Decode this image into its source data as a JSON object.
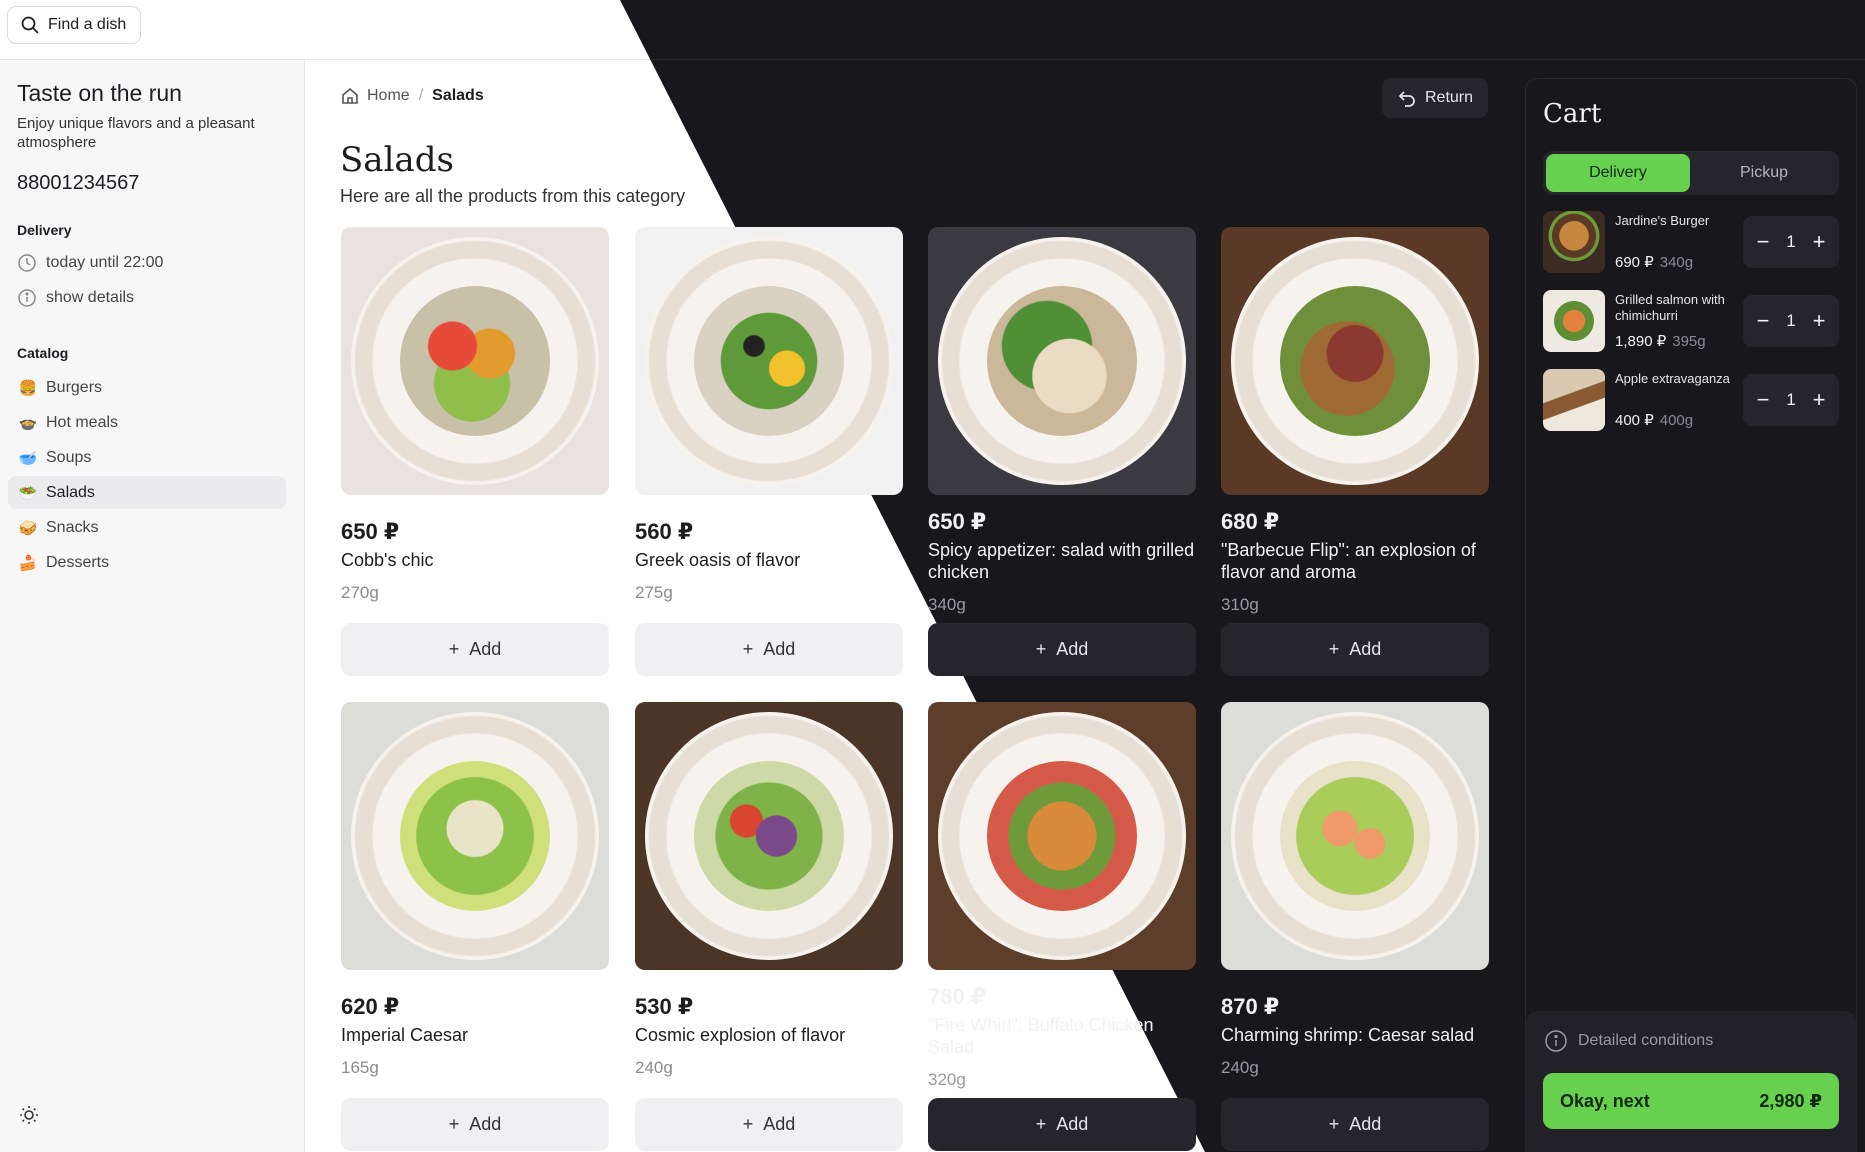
{
  "search": {
    "label": "Find a dish"
  },
  "sidebar": {
    "title": "Taste on the run",
    "subtitle": "Enjoy unique flavors and a pleasant atmosphere",
    "phone": "88001234567",
    "delivery_heading": "Delivery",
    "delivery_time": "today until 22:00",
    "show_details": "show details",
    "catalog_heading": "Catalog",
    "categories": [
      {
        "label": "Burgers",
        "icon": "burger-icon",
        "active": false
      },
      {
        "label": "Hot meals",
        "icon": "hot-meal-icon",
        "active": false
      },
      {
        "label": "Soups",
        "icon": "soup-icon",
        "active": false
      },
      {
        "label": "Salads",
        "icon": "salad-icon",
        "active": true
      },
      {
        "label": "Snacks",
        "icon": "snack-icon",
        "active": false
      },
      {
        "label": "Desserts",
        "icon": "dessert-icon",
        "active": false
      }
    ]
  },
  "breadcrumb": {
    "home": "Home",
    "separator": "/",
    "current": "Salads"
  },
  "return_label": "Return",
  "page": {
    "title": "Salads",
    "subtitle": "Here are all the products from this category"
  },
  "add_label": "Add",
  "products": [
    {
      "price": "650 ₽",
      "name": "Cobb's chic",
      "weight": "270g"
    },
    {
      "price": "560 ₽",
      "name": "Greek oasis of flavor",
      "weight": "275g"
    },
    {
      "price": "650 ₽",
      "name": "Spicy appetizer: salad with grilled chicken",
      "weight": "340g"
    },
    {
      "price": "680 ₽",
      "name": "\"Barbecue Flip\": an explosion of flavor and aroma",
      "weight": "310g"
    },
    {
      "price": "620 ₽",
      "name": "Imperial Caesar",
      "weight": "165g"
    },
    {
      "price": "530 ₽",
      "name": "Cosmic explosion of flavor",
      "weight": "240g"
    },
    {
      "price": "780 ₽",
      "name": "\"Fire Whirl\": Buffalo Chicken Salad",
      "weight": "320g"
    },
    {
      "price": "870 ₽",
      "name": "Charming shrimp: Caesar salad",
      "weight": "240g"
    }
  ],
  "cart": {
    "title": "Cart",
    "delivery_tab": "Delivery",
    "pickup_tab": "Pickup",
    "items": [
      {
        "name": "Jardine's Burger",
        "price": "690 ₽",
        "weight": "340g",
        "qty": "1"
      },
      {
        "name": "Grilled salmon with chimichurri",
        "price": "1,890 ₽",
        "weight": "395g",
        "qty": "1"
      },
      {
        "name": "Apple extravaganza",
        "price": "400 ₽",
        "weight": "400g",
        "qty": "1"
      }
    ],
    "conditions": "Detailed conditions",
    "next_label": "Okay, next",
    "total": "2,980 ₽"
  },
  "colors": {
    "accent": "#67d14f",
    "dark_bg": "#18171c",
    "light_bg": "#ffffff"
  }
}
